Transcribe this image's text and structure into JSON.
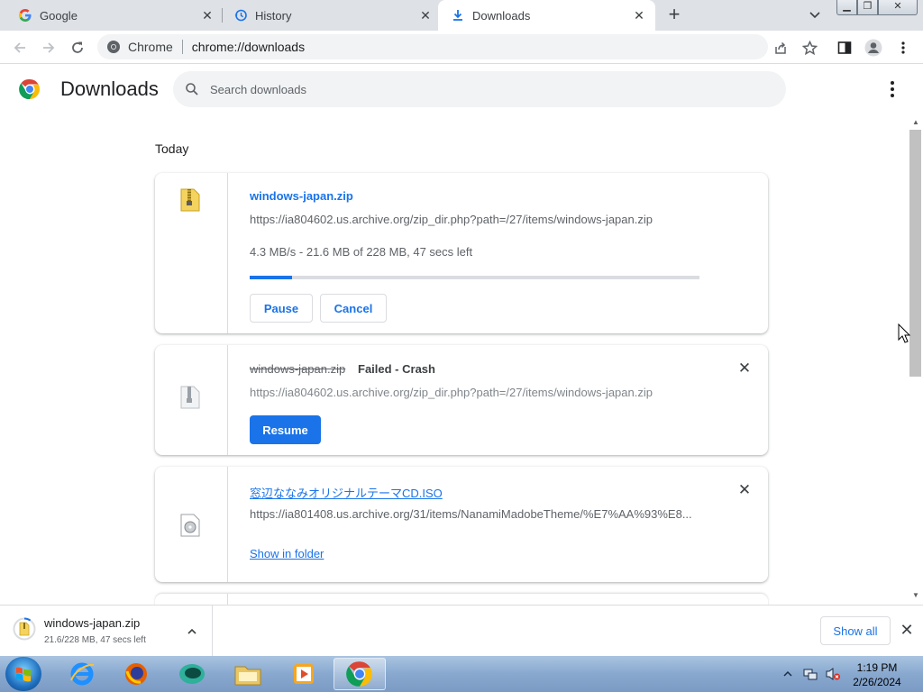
{
  "tabs": [
    {
      "label": "Google",
      "icon": "google-icon"
    },
    {
      "label": "History",
      "icon": "history-icon"
    },
    {
      "label": "Downloads",
      "icon": "download-icon",
      "active": true
    }
  ],
  "omnibox": {
    "chip": "Chrome",
    "url": "chrome://downloads"
  },
  "page": {
    "title": "Downloads",
    "search_placeholder": "Search downloads",
    "date_header": "Today"
  },
  "downloads": [
    {
      "filename": "windows-japan.zip",
      "url": "https://ia804602.us.archive.org/zip_dir.php?path=/27/items/windows-japan.zip",
      "progress_text": "4.3 MB/s - 21.6 MB of 228 MB, 47 secs left",
      "progress_fraction": 0.095,
      "buttons": [
        "Pause",
        "Cancel"
      ]
    },
    {
      "filename": "windows-japan.zip",
      "status": "Failed - Crash",
      "url": "https://ia804602.us.archive.org/zip_dir.php?path=/27/items/windows-japan.zip",
      "buttons": [
        "Resume"
      ]
    },
    {
      "filename": "窓辺ななみオリジナルテーマCD.ISO",
      "url": "https://ia801408.us.archive.org/31/items/NanamiMadobeTheme/%E7%AA%93%E8...",
      "link": "Show in folder"
    }
  ],
  "shelf": {
    "filename": "windows-japan.zip",
    "status": "21.6/228 MB, 47 secs left",
    "show_all": "Show all"
  },
  "taskbar": {
    "time": "1:19 PM",
    "date": "2/26/2024"
  }
}
